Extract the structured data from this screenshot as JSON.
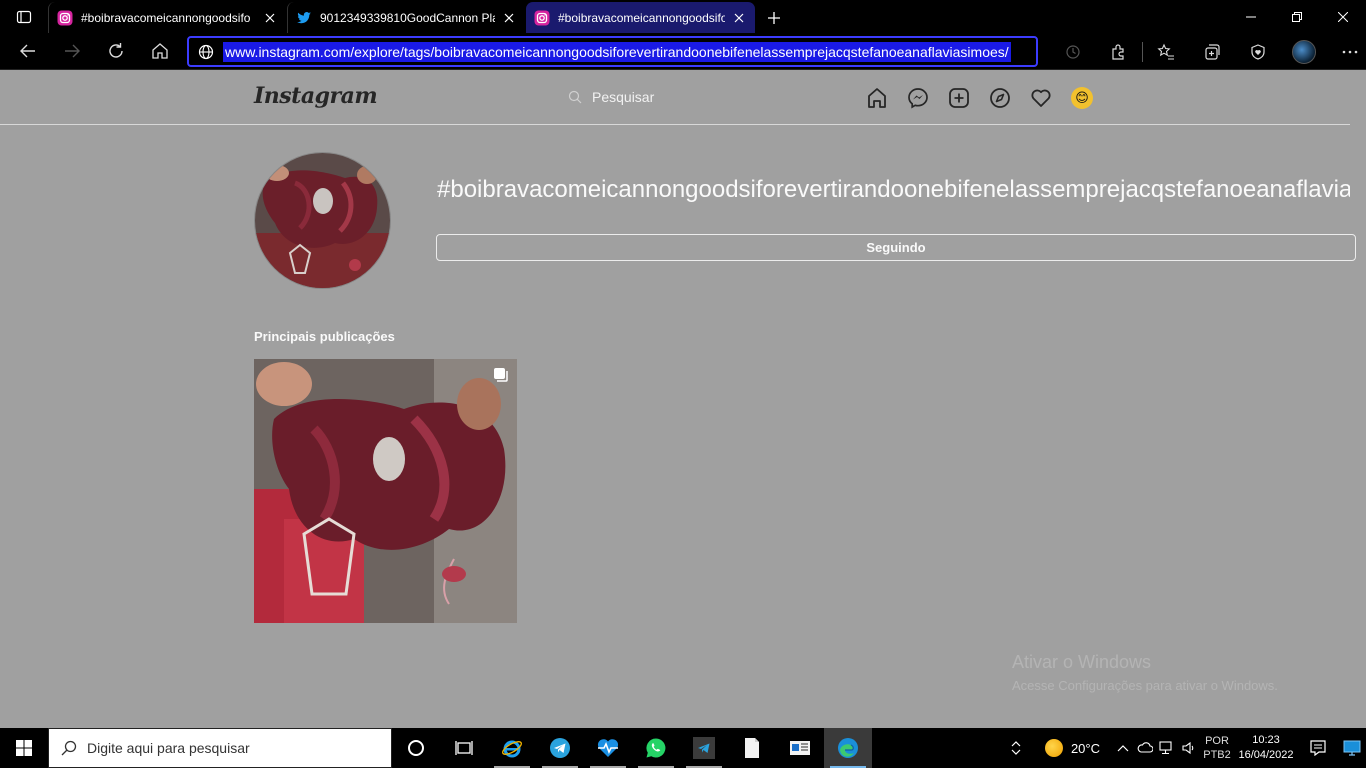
{
  "browser": {
    "tabs": [
      {
        "title": "#boibravacomeicannongoodsifo",
        "icon": "instagram-icon",
        "active": false
      },
      {
        "title": "9012349339810GoodCannon Pla",
        "icon": "twitter-icon",
        "active": false
      },
      {
        "title": "#boibravacomeicannongoodsifo",
        "icon": "instagram-icon",
        "active": true
      }
    ],
    "url": "www.instagram.com/explore/tags/boibravacomeicannongoodsiforevertirandoonebifenelassemprejacqstefanoeanaflaviasimoes/",
    "accent_color": "#1a1ae6"
  },
  "instagram": {
    "logo": "Instagram",
    "search_placeholder": "Pesquisar",
    "hashtag_title": "#boibravacomeicannongoodsiforevertirandoonebifenelassemprejacqstefanoeanaflaviasimoes",
    "follow_button": "Seguindo",
    "top_posts_title": "Principais publicações"
  },
  "windows_watermark": {
    "line1": "Ativar o Windows",
    "line2": "Acesse Configurações para ativar o Windows."
  },
  "taskbar": {
    "search_placeholder": "Digite aqui para pesquisar",
    "weather_temp": "20°C",
    "language": "POR",
    "keyboard": "PTB2",
    "time": "10:23",
    "date": "16/04/2022"
  }
}
